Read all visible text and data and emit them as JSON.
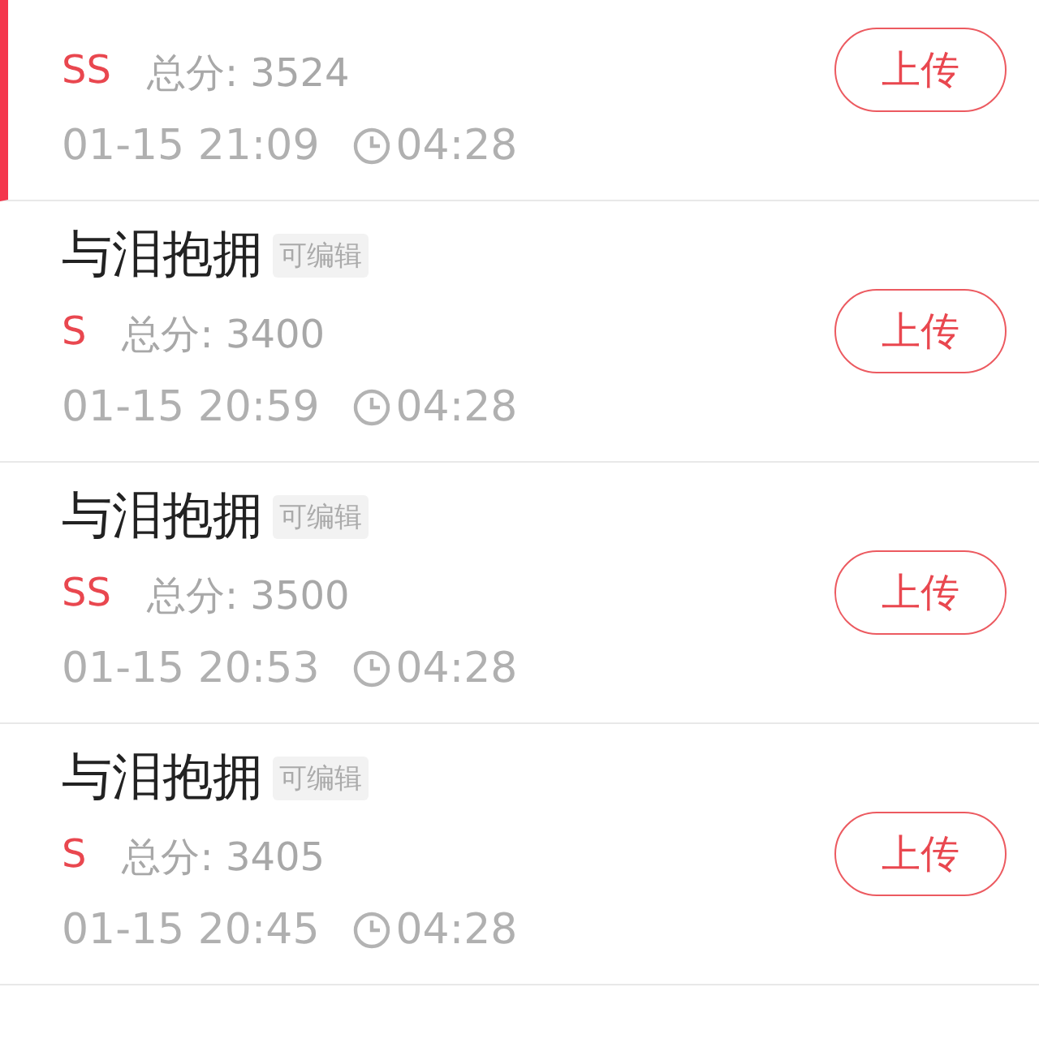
{
  "records": [
    {
      "grade": "SS",
      "score": "总分: 3524",
      "date": "01-15 21:09",
      "duration": "04:28",
      "action": "上传",
      "selected": true
    },
    {
      "title": "与泪抱拥",
      "tag": "可编辑",
      "grade": "S",
      "score": "总分: 3400",
      "date": "01-15 20:59",
      "duration": "04:28",
      "action": "上传",
      "selected": false
    },
    {
      "title": "与泪抱拥",
      "tag": "可编辑",
      "grade": "SS",
      "score": "总分: 3500",
      "date": "01-15 20:53",
      "duration": "04:28",
      "action": "上传",
      "selected": false
    },
    {
      "title": "与泪抱拥",
      "tag": "可编辑",
      "grade": "S",
      "score": "总分: 3405",
      "date": "01-15 20:45",
      "duration": "04:28",
      "action": "上传",
      "selected": false
    }
  ]
}
